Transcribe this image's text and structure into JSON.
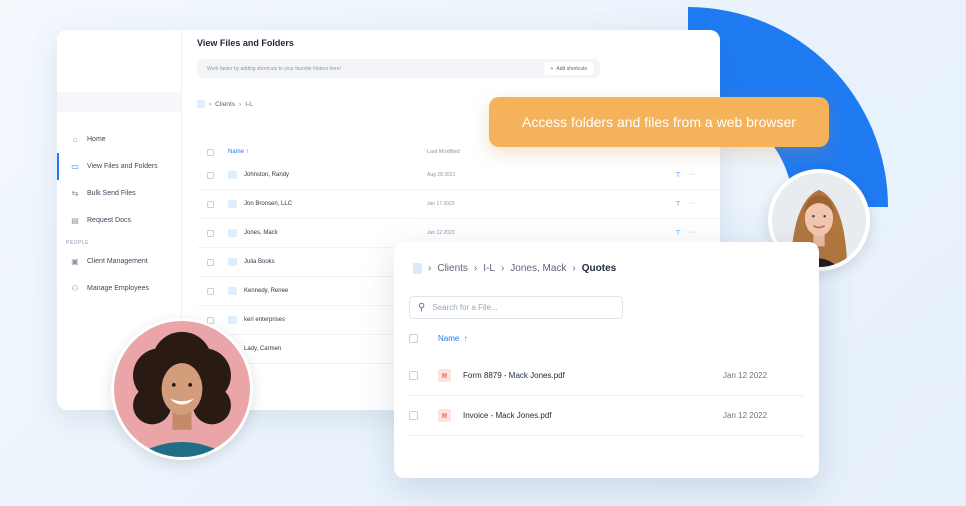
{
  "main_window": {
    "title": "View Files and Folders",
    "shortcut_hint": "Work faster by adding shortcuts to your favorite folders here!",
    "add_shortcuts_label": "Add shortcuts",
    "breadcrumb": [
      "Clients",
      "I-L"
    ],
    "sidebar": {
      "items": [
        {
          "label": "Home",
          "icon": "home-icon"
        },
        {
          "label": "View Files and Folders",
          "icon": "folder-icon"
        },
        {
          "label": "Bulk Send Files",
          "icon": "send-icon"
        },
        {
          "label": "Request Docs",
          "icon": "document-icon"
        }
      ],
      "section_label": "PEOPLE",
      "people_items": [
        {
          "label": "Client Management",
          "icon": "briefcase-icon"
        },
        {
          "label": "Manage Employees",
          "icon": "users-icon"
        }
      ]
    },
    "table": {
      "col_name": "Name",
      "col_modified": "Last Modified",
      "rows": [
        {
          "name": "Johnston, Randy",
          "date": "Aug 28 2021"
        },
        {
          "name": "Jon Bronsen, LLC",
          "date": "Jan 17 2023"
        },
        {
          "name": "Jones, Mack",
          "date": "Jan 12 2023"
        },
        {
          "name": "Julia Books",
          "date": ""
        },
        {
          "name": "Kennedy, Renee",
          "date": ""
        },
        {
          "name": "keri enterprises",
          "date": ""
        },
        {
          "name": "Lady, Carmen",
          "date": ""
        }
      ]
    }
  },
  "tooltip": {
    "text": "Access folders and files from a web browser"
  },
  "second_window": {
    "breadcrumb": [
      "Clients",
      "I-L",
      "Jones, Mack",
      "Quotes"
    ],
    "search_placeholder": "Search for a File...",
    "col_name": "Name",
    "files": [
      {
        "name": "Form 8879 - Mack Jones.pdf",
        "date": "Jan 12 2022"
      },
      {
        "name": "Invoice - Mack Jones.pdf",
        "date": "Jan 12 2022"
      }
    ]
  },
  "colors": {
    "accent": "#1f7bf2",
    "tooltip": "#f4b25a"
  }
}
